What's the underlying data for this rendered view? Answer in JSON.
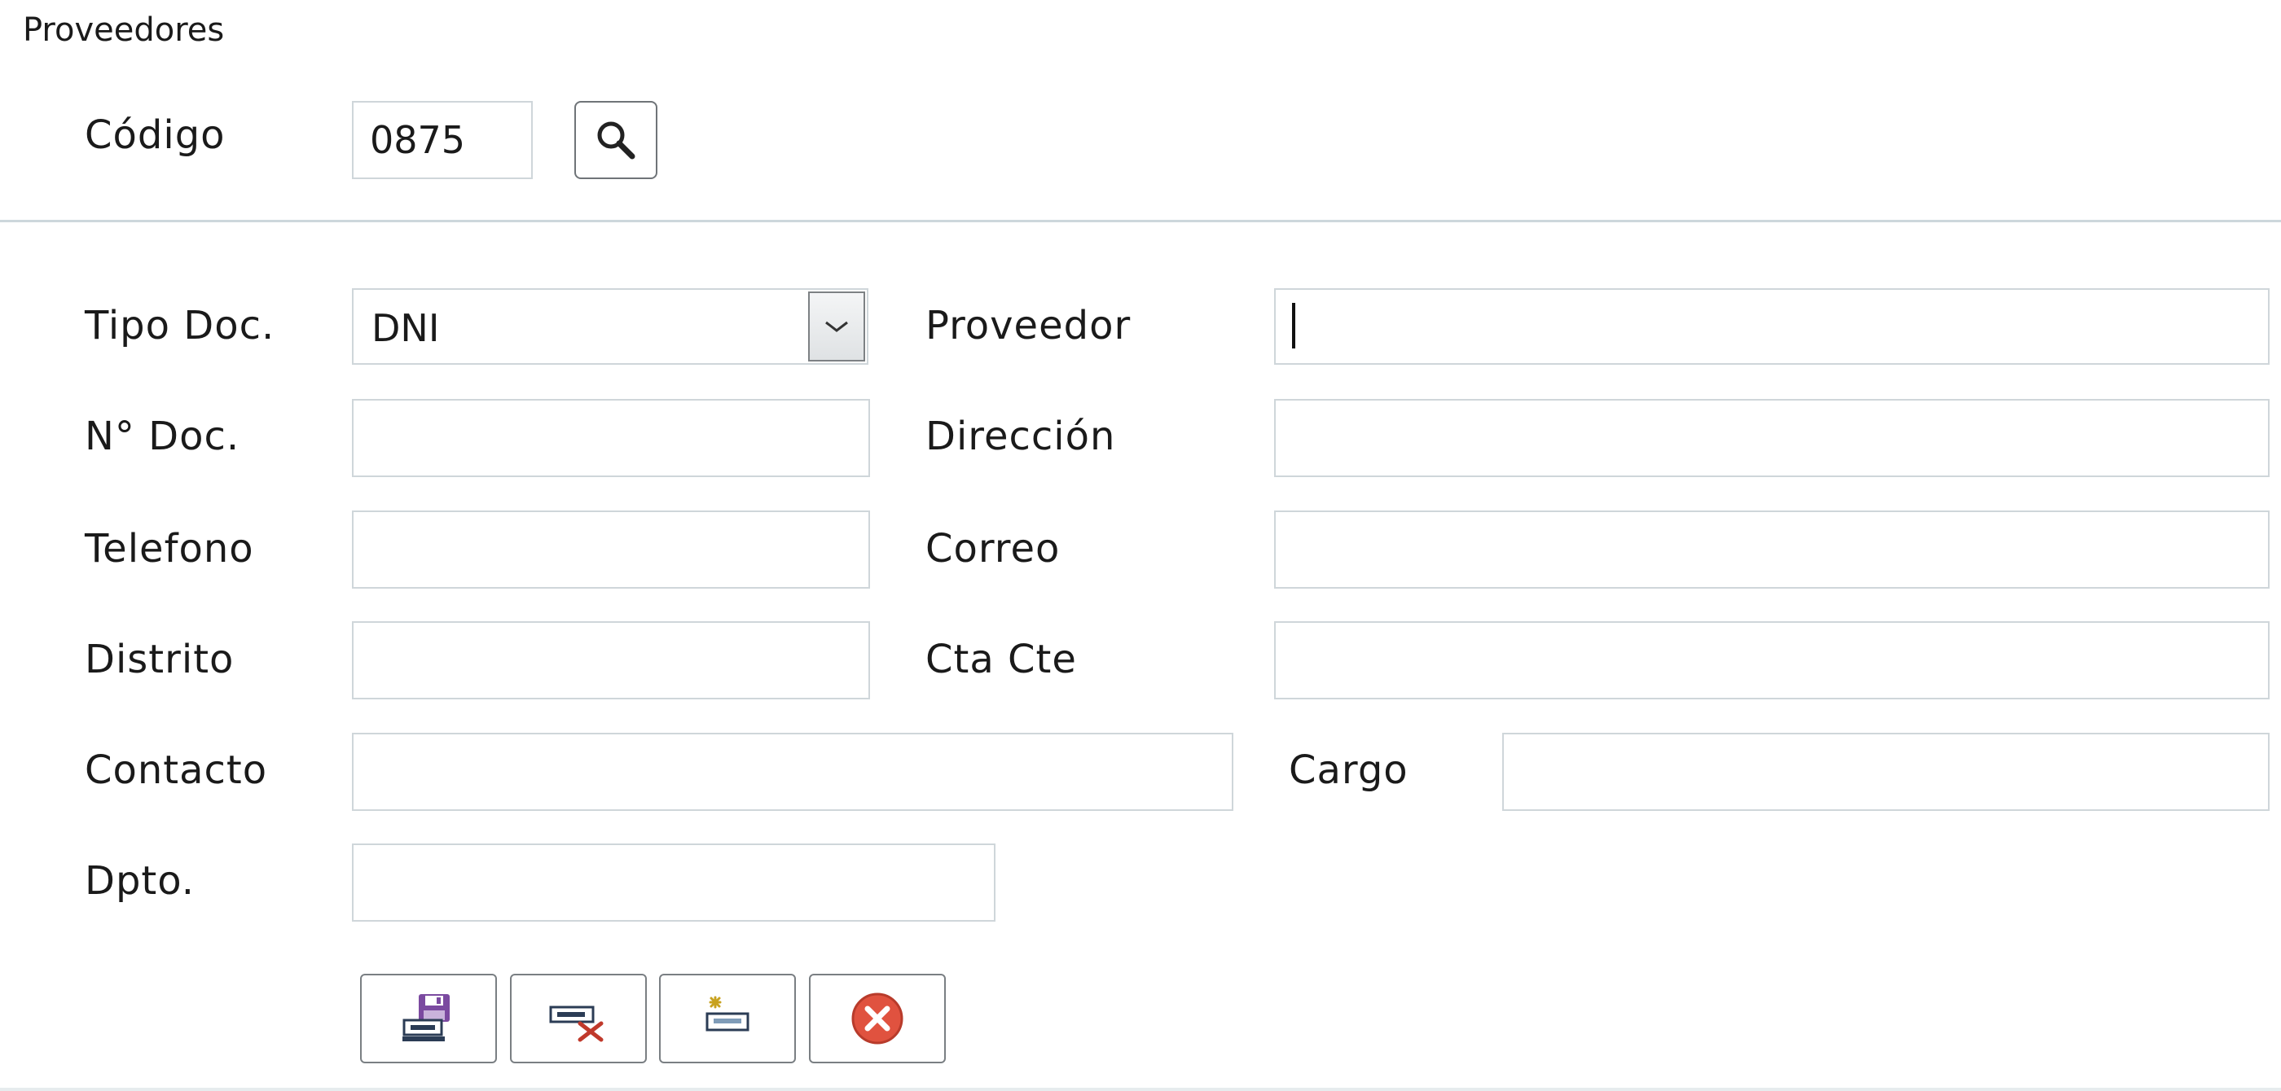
{
  "window": {
    "title": "Proveedores"
  },
  "search": {
    "codigo_label": "Código",
    "codigo_value": "0875",
    "search_icon": "magnifier-icon"
  },
  "form": {
    "tipo_doc_label": "Tipo Doc.",
    "tipo_doc_value": "DNI",
    "proveedor_label": "Proveedor",
    "proveedor_value": "",
    "n_doc_label": "N° Doc.",
    "n_doc_value": "",
    "direccion_label": "Dirección",
    "direccion_value": "",
    "telefono_label": "Telefono",
    "telefono_value": "",
    "correo_label": "Correo",
    "correo_value": "",
    "distrito_label": "Distrito",
    "distrito_value": "",
    "cta_cte_label": "Cta Cte",
    "cta_cte_value": "",
    "contacto_label": "Contacto",
    "contacto_value": "",
    "cargo_label": "Cargo",
    "cargo_value": "",
    "dpto_label": "Dpto.",
    "dpto_value": ""
  },
  "actions": [
    {
      "name": "save",
      "icon": "floppy-disk-icon"
    },
    {
      "name": "delete",
      "icon": "remove-record-icon"
    },
    {
      "name": "new",
      "icon": "new-record-icon"
    },
    {
      "name": "close",
      "icon": "close-circle-icon"
    }
  ],
  "colors": {
    "border": "#cfd6da",
    "close_red": "#e0523f",
    "save_purple": "#7b4aa0"
  }
}
